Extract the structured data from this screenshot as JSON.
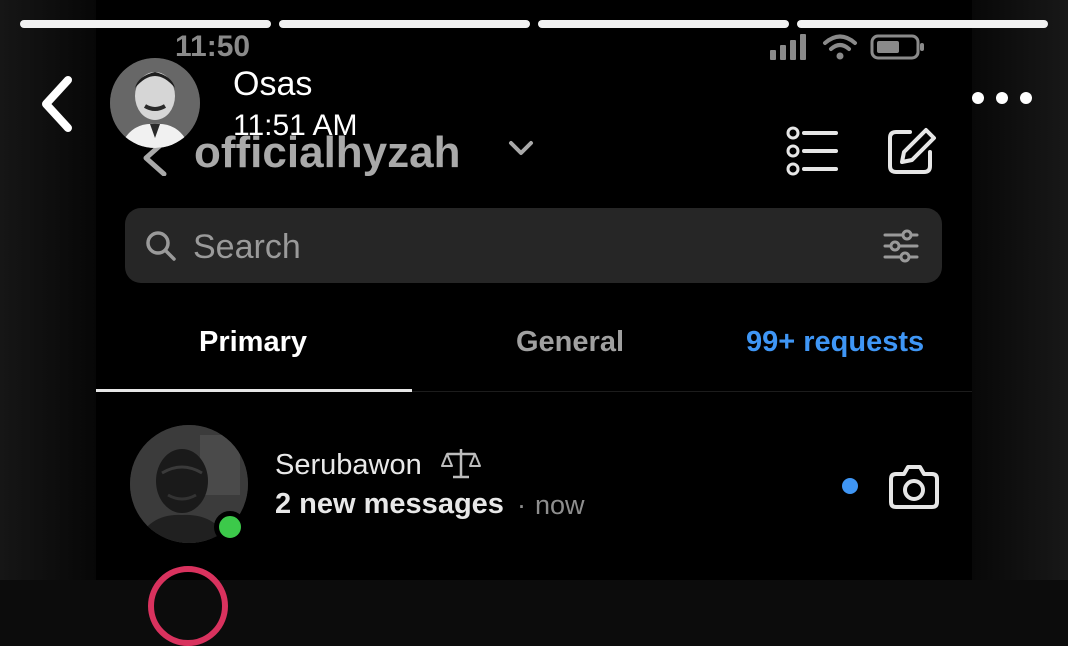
{
  "story": {
    "progress_segments": 4,
    "author_name": "Osas",
    "posted_time": "11:51 AM"
  },
  "status_bar": {
    "time": "11:50"
  },
  "dm": {
    "username": "officialhyzah",
    "search_placeholder": "Search",
    "tabs": [
      {
        "label": "Primary",
        "active": true
      },
      {
        "label": "General",
        "active": false
      },
      {
        "label": "99+ requests",
        "active": false
      }
    ],
    "conversations": [
      {
        "name": "Serubawon",
        "preview": "2 new messages",
        "separator": "·",
        "time": "now",
        "online": true,
        "unread": true
      }
    ]
  },
  "icons": {
    "story_back": "chevron-left-icon",
    "more": "more-horizontal-icon",
    "list": "list-icon",
    "compose": "edit-icon",
    "search": "search-icon",
    "filter": "filter-icon",
    "camera": "camera-icon",
    "scale": "scale-icon"
  },
  "colors": {
    "accent_blue": "#3f96f5",
    "online_green": "#3cc94a",
    "background": "#000000",
    "search_bg": "#262626"
  }
}
